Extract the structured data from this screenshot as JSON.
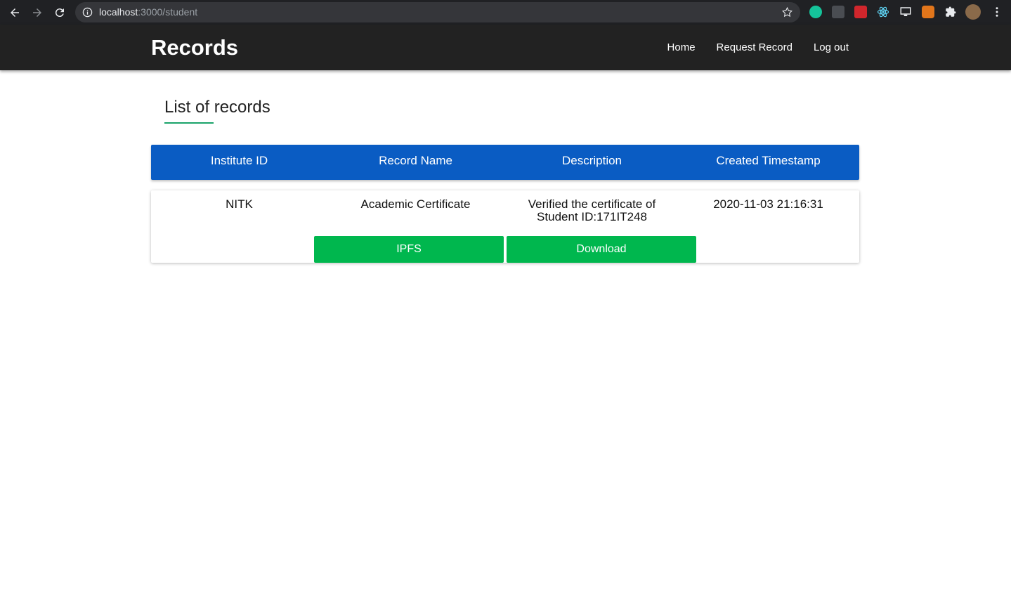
{
  "browser": {
    "url_host": "localhost",
    "url_path": ":3000/student"
  },
  "navbar": {
    "brand": "Records",
    "links": [
      "Home",
      "Request Record",
      "Log out"
    ]
  },
  "main": {
    "heading": "List of records",
    "table": {
      "columns": [
        "Institute ID",
        "Record Name",
        "Description",
        "Created Timestamp"
      ],
      "rows": [
        {
          "institute_id": "NITK",
          "record_name": "Academic Certificate",
          "description_line1": "Verified the certificate of",
          "description_line2": "Student ID:171IT248",
          "created_timestamp": "2020-11-03 21:16:31",
          "ipfs_label": "IPFS",
          "download_label": "Download"
        }
      ]
    }
  },
  "colors": {
    "navbar": "#222222",
    "table_header": "#0a5cc3",
    "button": "#00b74e",
    "underline": "#1aa36a"
  }
}
